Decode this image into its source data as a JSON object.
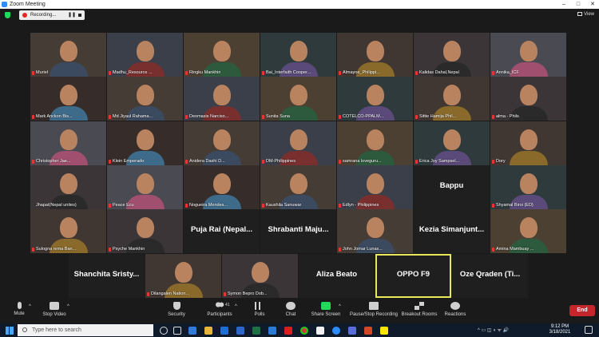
{
  "window": {
    "title": "Zoom Meeting",
    "minimize": "–",
    "maximize": "□",
    "close": "✕"
  },
  "recording": {
    "label": "Recording...",
    "pause": "❚❚"
  },
  "view": {
    "label": "View"
  },
  "participants": [
    {
      "name": "Muriel",
      "muted": true,
      "video": true
    },
    {
      "name": "Madhu_Resource ...",
      "muted": true,
      "video": true
    },
    {
      "name": "Ringku Mankhin",
      "muted": true,
      "video": true
    },
    {
      "name": "Bai_Interfaith Cooper...",
      "muted": true,
      "video": true
    },
    {
      "name": "Almayne_Philippi...",
      "muted": true,
      "video": true
    },
    {
      "name": "Kalidas Dahal,Nepal",
      "muted": true,
      "video": true
    },
    {
      "name": "Annika_ICF",
      "muted": true,
      "video": true
    },
    {
      "name": "Mark Anckon Bis...",
      "muted": true,
      "video": true
    },
    {
      "name": "Md Jiyaul Rahama...",
      "muted": true,
      "video": true
    },
    {
      "name": "Deomasis Narciso...",
      "muted": true,
      "video": true
    },
    {
      "name": "Sunita Suna",
      "muted": true,
      "video": true
    },
    {
      "name": "COTELCO-PPALM...",
      "muted": true,
      "video": true
    },
    {
      "name": "Sittie Hamija Phil...",
      "muted": true,
      "video": true
    },
    {
      "name": "alma - Phils",
      "muted": true,
      "video": true
    },
    {
      "name": "Christopher Jae...",
      "muted": true,
      "video": true
    },
    {
      "name": "Klein Emperado",
      "muted": true,
      "video": true
    },
    {
      "name": "Anidera Dashi D...",
      "muted": true,
      "video": true
    },
    {
      "name": "DM-Philippines",
      "muted": true,
      "video": true
    },
    {
      "name": "samrana loveguru...",
      "muted": true,
      "video": true
    },
    {
      "name": "Erica Joy Sampsel...",
      "muted": true,
      "video": true
    },
    {
      "name": "Dory",
      "muted": true,
      "video": true
    },
    {
      "name": "Jhapat(Nepal unites)",
      "muted": false,
      "video": true
    },
    {
      "name": "Peace Ecu",
      "muted": true,
      "video": true
    },
    {
      "name": "Nogueira Mendes...",
      "muted": true,
      "video": true
    },
    {
      "name": "Kaushila Sanuwar",
      "muted": true,
      "video": true
    },
    {
      "name": "Edlyn - Philippines",
      "muted": true,
      "video": true
    },
    {
      "name": "Bappu",
      "muted": true,
      "video": false
    },
    {
      "name": "Shyamal Biroi (ED)",
      "muted": true,
      "video": true
    },
    {
      "name": "Sulogna rema Ban...",
      "muted": true,
      "video": true
    },
    {
      "name": "Psyche Mankhin",
      "muted": true,
      "video": true
    },
    {
      "name": "Puja Rai (Nepal...",
      "muted": false,
      "video": false
    },
    {
      "name": "Shrabanti Maju...",
      "muted": false,
      "video": false
    },
    {
      "name": "John Jomar Lunas...",
      "muted": true,
      "video": true
    },
    {
      "name": "Kezia Simanjunt...",
      "muted": false,
      "video": false
    },
    {
      "name": "Amina Mambuay ...",
      "muted": true,
      "video": true
    },
    {
      "name": "Shanchita Sristy...",
      "muted": false,
      "video": false
    },
    {
      "name": "Dilangalen Nation...",
      "muted": true,
      "video": true
    },
    {
      "name": "Symon Bepro Dob...",
      "muted": true,
      "video": true
    },
    {
      "name": "Aliza Beato",
      "muted": false,
      "video": false
    },
    {
      "name": "OPPO F9",
      "muted": false,
      "video": false,
      "active": true
    },
    {
      "name": "Oze Qraden (Ti...",
      "muted": false,
      "video": false
    }
  ],
  "toolbar": {
    "mute": "Mute",
    "stop_video": "Stop Video",
    "security": "Security",
    "participants": "Participants",
    "participant_count": "41",
    "polls": "Polls",
    "chat": "Chat",
    "share_screen": "Share Screen",
    "record": "Pause/Stop Recording",
    "breakout": "Breakout Rooms",
    "reactions": "Reactions",
    "end": "End"
  },
  "taskbar": {
    "search_placeholder": "Type here to search",
    "time": "9:12 PM",
    "date": "3/18/2021"
  },
  "colors": {
    "accent_green": "#23d959",
    "end_red": "#c4262c",
    "active_speaker": "#e8e85a",
    "taskbar": "#0f1b2b"
  }
}
